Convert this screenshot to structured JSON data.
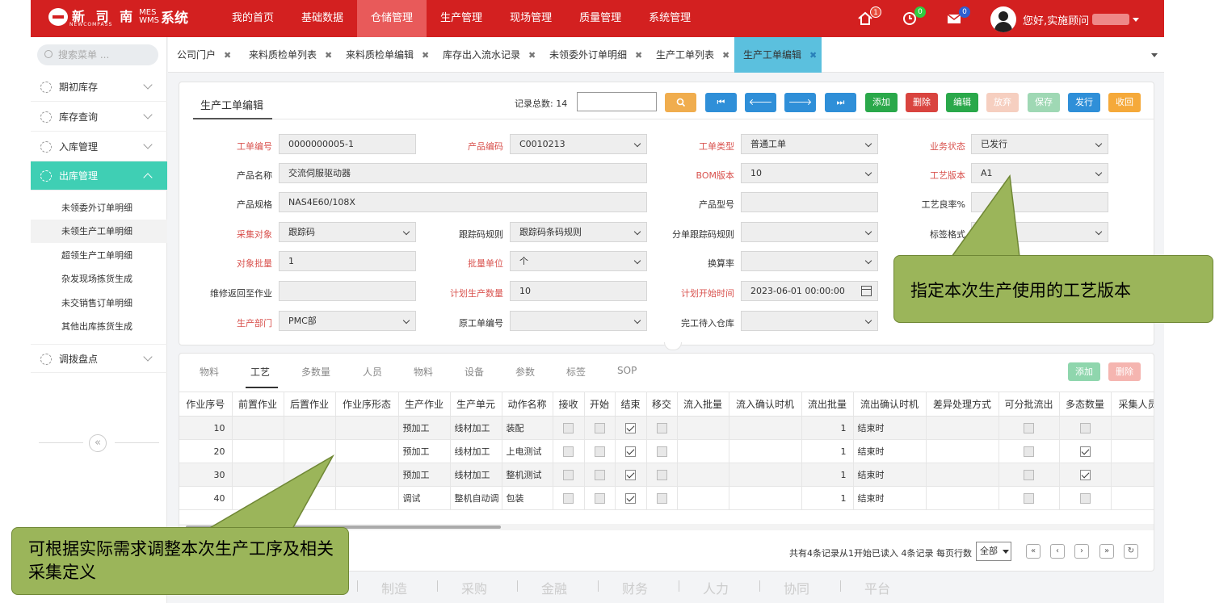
{
  "app": {
    "logo_cn": "新 司 南",
    "logo_en": "NEWCOMPASS",
    "logo_sys_top": "MES",
    "logo_sys_bottom": "WMS",
    "logo_sys_cn": "系统"
  },
  "nav": [
    "我的首页",
    "基础数据",
    "仓储管理",
    "生产管理",
    "现场管理",
    "质量管理",
    "系统管理"
  ],
  "badges": {
    "home": "1",
    "clock": "0",
    "mail": "0"
  },
  "colors": {
    "topbar": "#d32020",
    "sidebar_active": "#3fcfb4",
    "tab_active": "#5bc0de",
    "callout": "#9bb55a"
  },
  "user": {
    "greeting": "您好,实施顾问"
  },
  "sidebar": {
    "search_placeholder": "搜索菜单 ...",
    "menus": [
      "期初库存",
      "库存查询",
      "入库管理",
      "出库管理",
      "调拨盘点"
    ],
    "submenus": [
      "未领委外订单明细",
      "未领生产工单明细",
      "超领生产工单明细",
      "杂发现场拣货生成",
      "未交销售订单明细",
      "其他出库拣货生成"
    ]
  },
  "tabs": [
    "公司门户",
    "来料质检单列表",
    "来料质检单编辑",
    "库存出入流水记录",
    "未领委外订单明细",
    "生产工单列表",
    "生产工单编辑"
  ],
  "form": {
    "title": "生产工单编辑",
    "record_count_label": "记录总数:",
    "record_count": "14",
    "buttons": {
      "add": "添加",
      "delete": "删除",
      "edit": "编辑",
      "discard": "放弃",
      "save": "保存",
      "release": "发行",
      "recall": "收回"
    },
    "fields": {
      "order_no": {
        "label": "工单编号",
        "value": "0000000005-1"
      },
      "product_code": {
        "label": "产品编码",
        "value": "C0010213"
      },
      "order_type": {
        "label": "工单类型",
        "value": "普通工单"
      },
      "biz_status": {
        "label": "业务状态",
        "value": "已发行"
      },
      "product_name": {
        "label": "产品名称",
        "value": "交流伺服驱动器"
      },
      "bom_version": {
        "label": "BOM版本",
        "value": "10"
      },
      "process_version": {
        "label": "工艺版本",
        "value": "A1"
      },
      "product_spec": {
        "label": "产品规格",
        "value": "NAS4E60/108X"
      },
      "product_model": {
        "label": "产品型号",
        "value": ""
      },
      "process_yield": {
        "label": "工艺良率%",
        "value": ""
      },
      "collect_object": {
        "label": "采集对象",
        "value": "跟踪码"
      },
      "trace_rule": {
        "label": "跟踪码规则",
        "value": "跟踪码条码规则"
      },
      "split_trace_rule": {
        "label": "分单跟踪码规则",
        "value": ""
      },
      "label_format": {
        "label": "标签格式",
        "value": ""
      },
      "object_batch": {
        "label": "对象批量",
        "value": "1"
      },
      "batch_unit": {
        "label": "批量单位",
        "value": "个"
      },
      "conversion_rate": {
        "label": "换算率",
        "value": ""
      },
      "repair_return": {
        "label": "维修返回至作业",
        "value": ""
      },
      "plan_qty": {
        "label": "计划生产数量",
        "value": "10"
      },
      "plan_start": {
        "label": "计划开始时间",
        "value": "2023-06-01 00:00:00"
      },
      "dept": {
        "label": "生产部门",
        "value": "PMC部"
      },
      "orig_order_no": {
        "label": "原工单编号",
        "value": ""
      },
      "finish_warehouse": {
        "label": "完工待入仓库",
        "value": ""
      }
    }
  },
  "detail": {
    "subtabs": [
      "物料",
      "工艺",
      "多数量",
      "人员",
      "物料",
      "设备",
      "参数",
      "标签",
      "SOP"
    ],
    "add": "添加",
    "delete": "删除",
    "columns": [
      "作业序号",
      "前置作业",
      "后置作业",
      "作业序形态",
      "生产作业",
      "生产单元",
      "动作名称",
      "接收",
      "开始",
      "结束",
      "移交",
      "流入批量",
      "流入确认时机",
      "流出批量",
      "流出确认时机",
      "差异处理方式",
      "可分批流出",
      "多态数量",
      "采集人员"
    ],
    "rows": [
      {
        "seq": "10",
        "op": "预加工",
        "unit": "线材加工",
        "action": "装配",
        "recv": false,
        "start": false,
        "end": true,
        "handover": false,
        "out_qty": "1",
        "out_time": "结束时",
        "split": false,
        "multi": false
      },
      {
        "seq": "20",
        "op": "预加工",
        "unit": "线材加工",
        "action": "上电测试",
        "recv": false,
        "start": false,
        "end": true,
        "handover": false,
        "out_qty": "1",
        "out_time": "结束时",
        "split": false,
        "multi": true
      },
      {
        "seq": "30",
        "op": "预加工",
        "unit": "线材加工",
        "action": "整机测试",
        "recv": false,
        "start": false,
        "end": true,
        "handover": false,
        "out_qty": "1",
        "out_time": "结束时",
        "split": false,
        "multi": true
      },
      {
        "seq": "40",
        "op": "调试",
        "unit": "整机自动调",
        "action": "包装",
        "recv": false,
        "start": false,
        "end": true,
        "handover": false,
        "out_qty": "1",
        "out_time": "结束时",
        "split": false,
        "multi": false
      }
    ],
    "pager_text": "共有4条记录从1开始已读入 4条记录  每页行数",
    "page_size": "全部"
  },
  "footer_menu": [
    "制造",
    "采购",
    "金融",
    "财务",
    "人力",
    "协同",
    "平台"
  ],
  "callouts": {
    "right": "指定本次生产使用的工艺版本",
    "left": "可根据实际需求调整本次生产工序及相关采集定义"
  }
}
